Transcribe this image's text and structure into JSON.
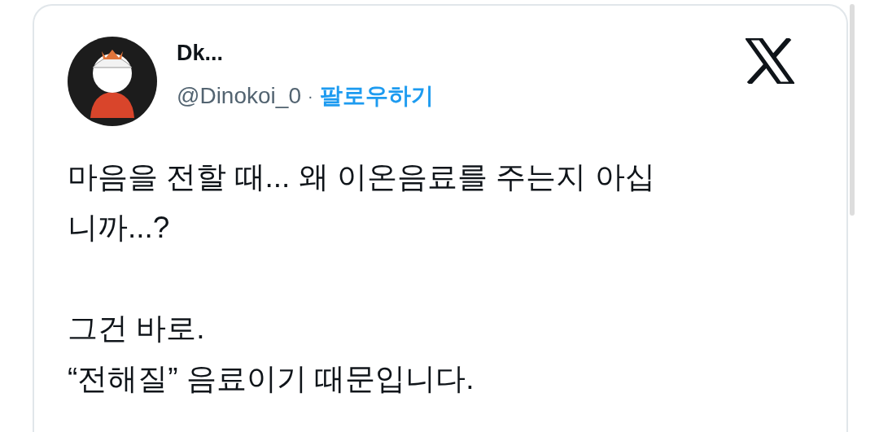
{
  "author": {
    "name": "Dk...",
    "handle": "@Dinokoi_0",
    "separator": "·",
    "follow": "팔로우하기"
  },
  "body": [
    [
      "마음을 전할 때... 왜 이온음료를 주는지 아십",
      "니까...?"
    ],
    [
      "그건 바로.",
      "“전해질” 음료이기 때문입니다."
    ]
  ]
}
